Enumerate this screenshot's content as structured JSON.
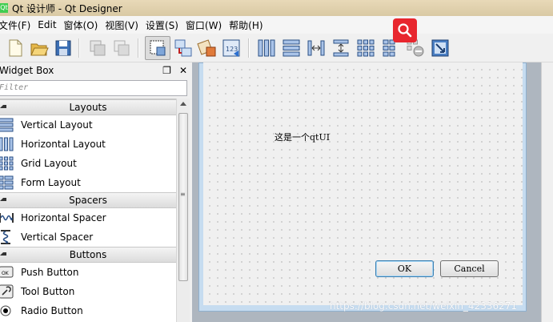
{
  "window": {
    "title": "Qt 设计师 - Qt Designer",
    "app_icon_text": "Qt"
  },
  "menubar": {
    "items": [
      "文件(F)",
      "Edit",
      "窗体(O)",
      "视图(V)",
      "设置(S)",
      "窗口(W)",
      "帮助(H)"
    ]
  },
  "toolbar": {
    "icons": [
      "new-file-icon",
      "open-folder-icon",
      "save-icon",
      "cut-icon",
      "paste-icon",
      "edit-widgets-icon",
      "edit-signals-slots-icon",
      "edit-buddies-icon",
      "edit-tab-order-icon",
      "layout-horizontal-icon",
      "layout-vertical-icon",
      "layout-horizontal-splitter-icon",
      "layout-vertical-splitter-icon",
      "layout-grid-icon",
      "layout-form-icon",
      "break-layout-icon",
      "adjust-size-icon"
    ]
  },
  "search_badge_icon": "search-icon",
  "widget_box": {
    "title": "Widget Box",
    "filter_placeholder": "Filter",
    "categories": [
      {
        "label": "Layouts",
        "items": [
          "Vertical Layout",
          "Horizontal Layout",
          "Grid Layout",
          "Form Layout"
        ]
      },
      {
        "label": "Spacers",
        "items": [
          "Horizontal Spacer",
          "Vertical Spacer"
        ]
      },
      {
        "label": "Buttons",
        "items": [
          "Push Button",
          "Tool Button",
          "Radio Button"
        ]
      }
    ]
  },
  "form": {
    "label_text": "这是一个qtUI",
    "ok_label": "OK",
    "cancel_label": "Cancel"
  },
  "watermark": "https://blog.csdn.net/weixin_42336271",
  "colors": {
    "accent_red": "#e8262e",
    "mdi_background": "#aeb6bf",
    "form_frame": "#c6dcf0"
  }
}
